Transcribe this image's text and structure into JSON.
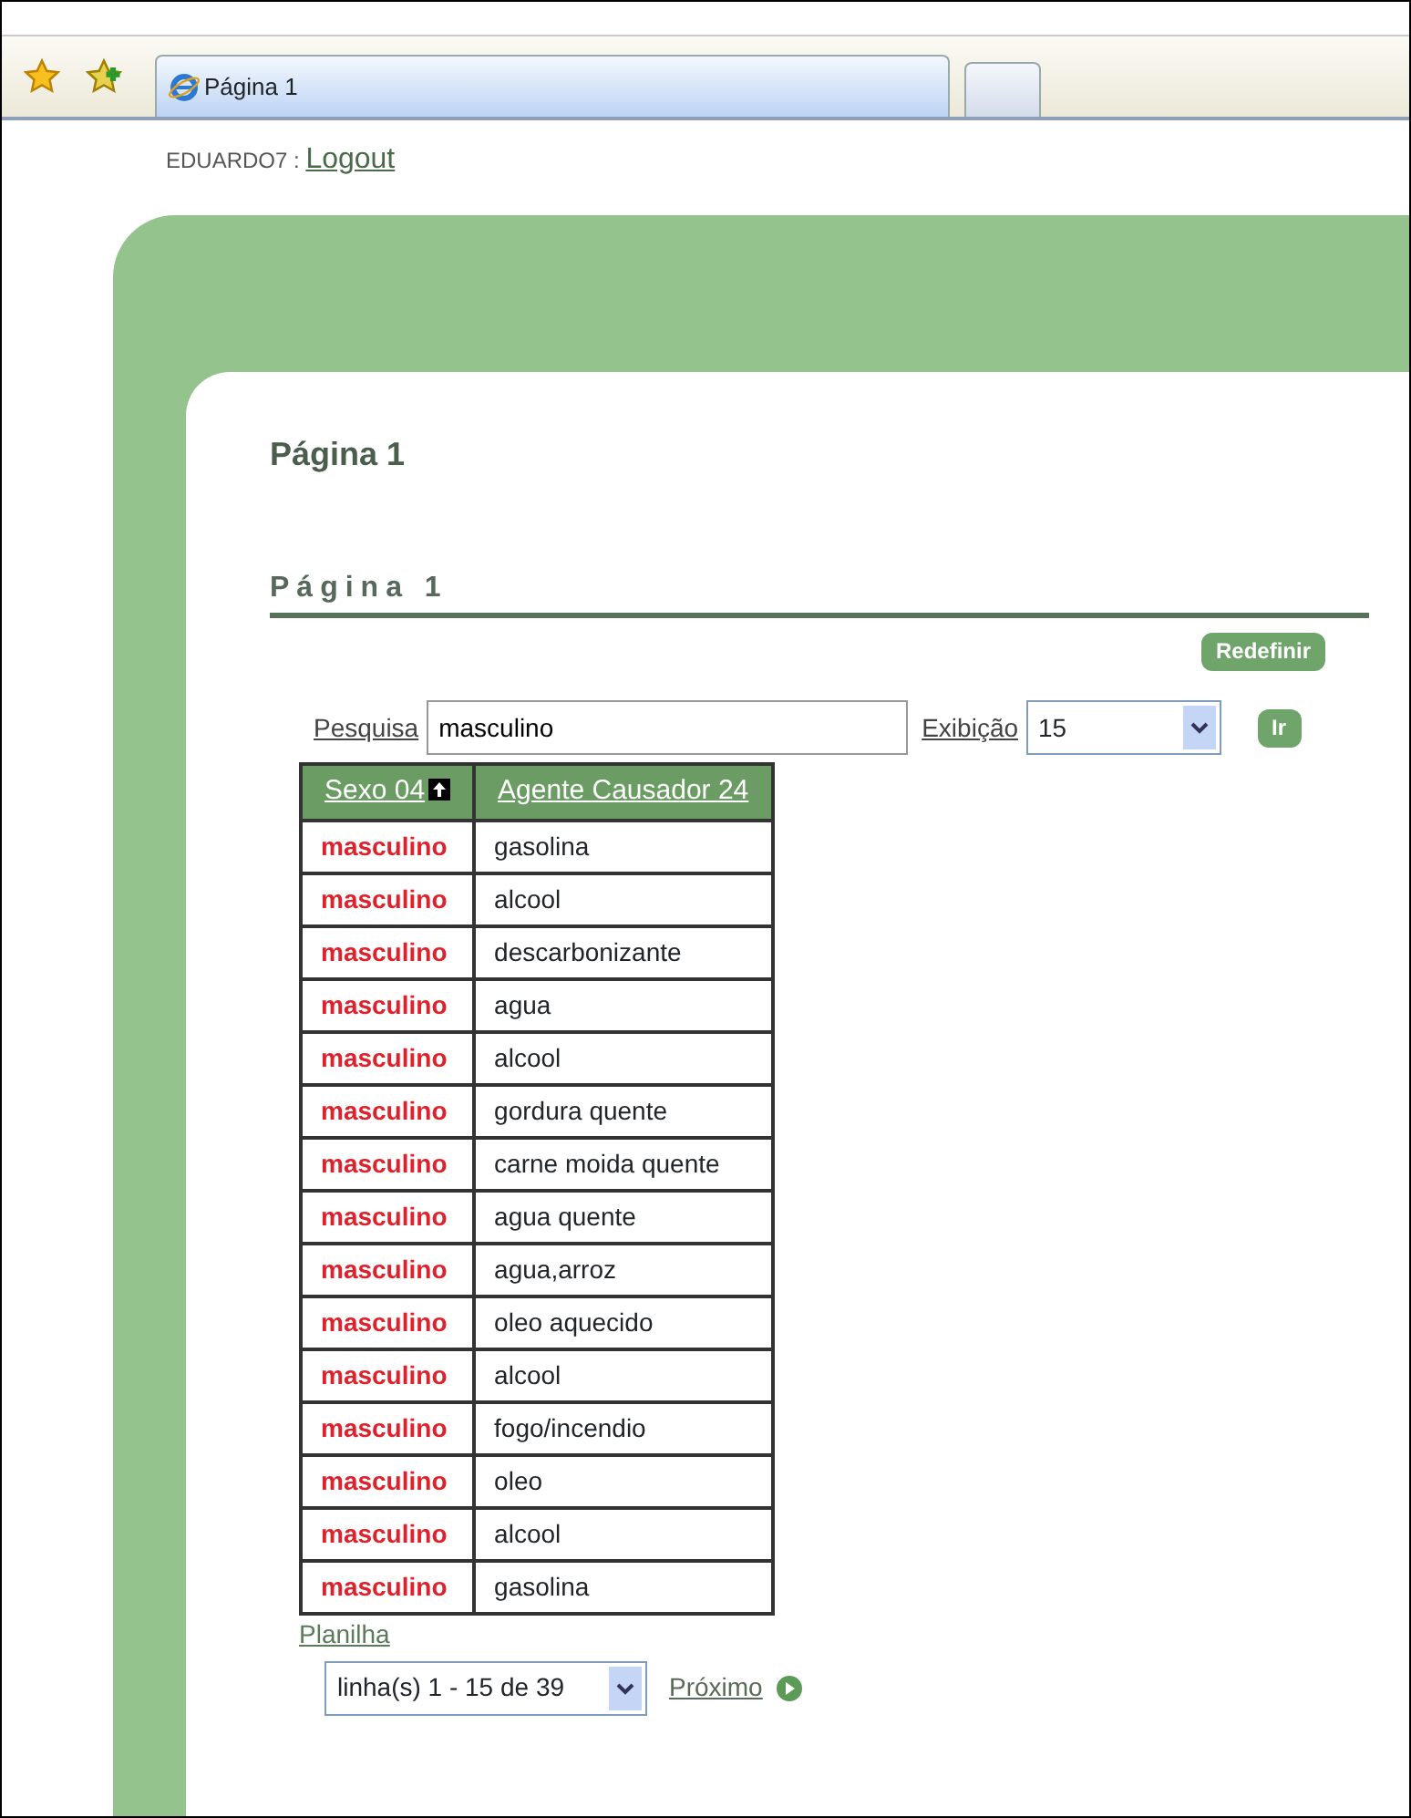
{
  "browser": {
    "tab_title": "Página 1"
  },
  "user": {
    "name": "EDUARDO7 :",
    "logout": "Logout"
  },
  "page_title": "Página 1",
  "region_title": "Página 1",
  "reset_button": "Redefinir",
  "search": {
    "label": "Pesquisa",
    "value": "masculino",
    "display_label": "Exibição",
    "display_value": "15",
    "go_button": "Ir"
  },
  "table": {
    "columns": [
      {
        "label": "Sexo 04",
        "sorted": true
      },
      {
        "label": "Agente Causador 24",
        "sorted": false
      }
    ],
    "rows": [
      [
        "masculino",
        "gasolina"
      ],
      [
        "masculino",
        "alcool"
      ],
      [
        "masculino",
        "descarbonizante"
      ],
      [
        "masculino",
        "agua"
      ],
      [
        "masculino",
        "alcool"
      ],
      [
        "masculino",
        "gordura quente"
      ],
      [
        "masculino",
        "carne moida quente"
      ],
      [
        "masculino",
        "agua quente"
      ],
      [
        "masculino",
        "agua,arroz"
      ],
      [
        "masculino",
        "oleo aquecido"
      ],
      [
        "masculino",
        "alcool"
      ],
      [
        "masculino",
        "fogo/incendio"
      ],
      [
        "masculino",
        "oleo"
      ],
      [
        "masculino",
        "alcool"
      ],
      [
        "masculino",
        "gasolina"
      ]
    ]
  },
  "download_link": "Planilha",
  "pagination": {
    "range": "linha(s) 1 - 15 de 39",
    "next": "Próximo"
  }
}
